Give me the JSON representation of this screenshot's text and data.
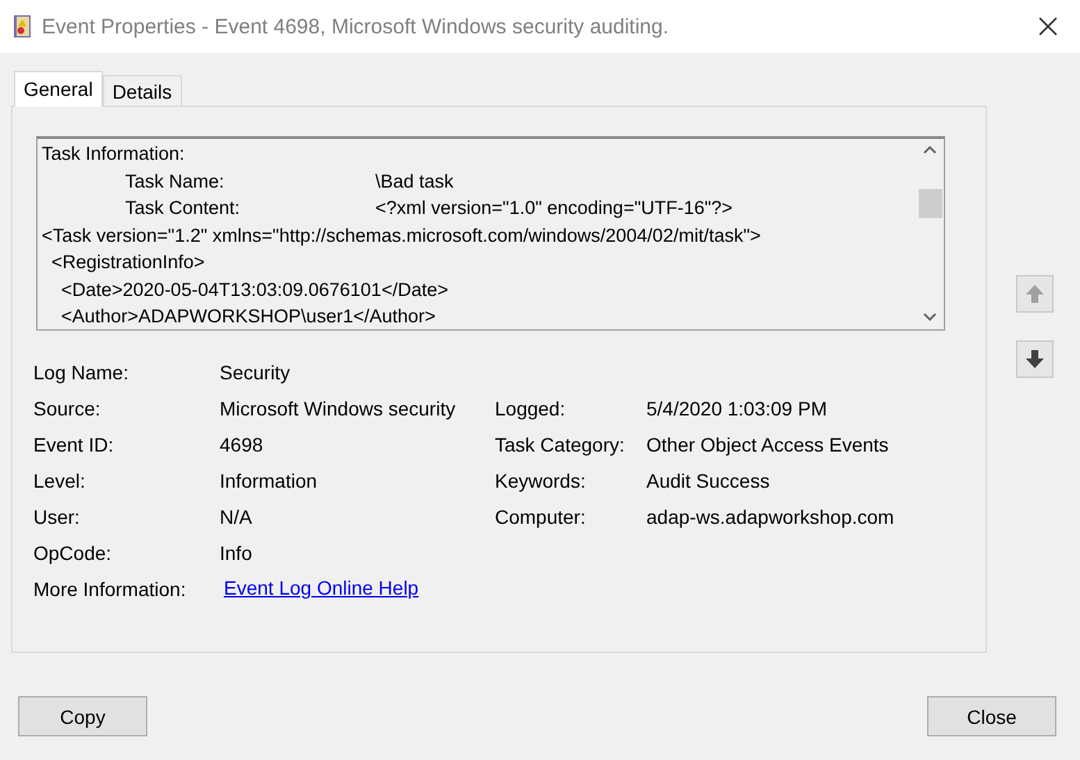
{
  "window": {
    "title": "Event Properties - Event 4698, Microsoft Windows security auditing."
  },
  "tabs": [
    {
      "label": "General",
      "selected": true
    },
    {
      "label": "Details",
      "selected": false
    }
  ],
  "description": [
    {
      "kind": "heading",
      "text": "Task Information:"
    },
    {
      "kind": "field",
      "label": "Task Name:",
      "value": "\\Bad task"
    },
    {
      "kind": "field",
      "label": "Task Content:",
      "value": "<?xml version=\"1.0\" encoding=\"UTF-16\"?>"
    },
    {
      "kind": "xml",
      "text": "<Task version=\"1.2\" xmlns=\"http://schemas.microsoft.com/windows/2004/02/mit/task\">",
      "children": [
        {
          "kind": "xml",
          "text": "<RegistrationInfo>",
          "children": [
            {
              "kind": "xml",
              "text": "<Date>2020-05-04T13:03:09.0676101</Date>"
            },
            {
              "kind": "xml",
              "text": "<Author>ADAPWORKSHOP\\user1</Author>"
            }
          ]
        }
      ]
    }
  ],
  "left_fields": [
    {
      "label": "Log Name:",
      "value": "Security"
    },
    {
      "label": "Source:",
      "value": "Microsoft Windows security"
    },
    {
      "label": "Event ID:",
      "value": "4698"
    },
    {
      "label": "Level:",
      "value": "Information"
    },
    {
      "label": "User:",
      "value": "N/A"
    },
    {
      "label": "OpCode:",
      "value": "Info"
    },
    {
      "label": "More Information:",
      "value": "Event Log Online Help",
      "kind": "link"
    }
  ],
  "right_fields": [
    {
      "label": "Logged:",
      "value": "5/4/2020 1:03:09 PM"
    },
    {
      "label": "Task Category:",
      "value": "Other Object Access Events"
    },
    {
      "label": "Keywords:",
      "value": "Audit Success"
    },
    {
      "label": "Computer:",
      "value": "adap-ws.adapworkshop.com"
    }
  ],
  "buttons": [
    {
      "label": "Copy"
    },
    {
      "label": "Close"
    }
  ]
}
